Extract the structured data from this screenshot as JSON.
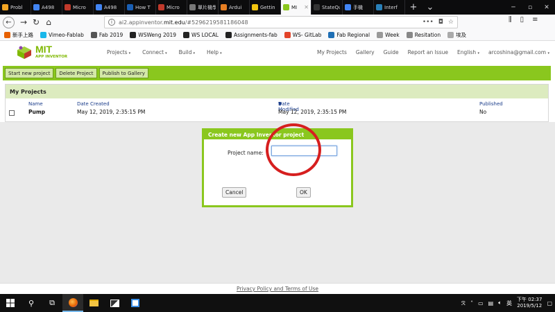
{
  "browser": {
    "tabs": [
      {
        "label": "Probl",
        "color": "#f5a623"
      },
      {
        "label": "A498",
        "color": "#4285f4"
      },
      {
        "label": "Micro",
        "color": "#c0392b"
      },
      {
        "label": "A498",
        "color": "#4285f4"
      },
      {
        "label": "How T",
        "color": "#1a5fb4"
      },
      {
        "label": "Micro",
        "color": "#c0392b"
      },
      {
        "label": "單片機學",
        "color": "#777777"
      },
      {
        "label": "Ardui",
        "color": "#e67e22"
      },
      {
        "label": "Gettin",
        "color": "#f1c40f"
      },
      {
        "label": "MI",
        "color": "#8ac71e",
        "active": true
      },
      {
        "label": "StateQui",
        "color": "#333333"
      },
      {
        "label": "手機",
        "color": "#4285f4"
      },
      {
        "label": "Interf",
        "color": "#2980b9"
      }
    ],
    "new_tab": "+",
    "url_prefix": "ai2.appinventor.",
    "url_host": "mit.edu",
    "url_path": "/#5296219581186048",
    "url_more": "•••",
    "bookmarks": [
      {
        "label": "新手上路",
        "color": "#e66000"
      },
      {
        "label": "Vimeo-Fablab",
        "color": "#1ab7ea"
      },
      {
        "label": "Fab 2019",
        "color": "#555555"
      },
      {
        "label": "WSWeng 2019",
        "color": "#222222"
      },
      {
        "label": "WS LOCAL",
        "color": "#222222"
      },
      {
        "label": "Assignments-fab",
        "color": "#222222"
      },
      {
        "label": "WS- GitLab",
        "color": "#e24329"
      },
      {
        "label": "Fab Regional",
        "color": "#1f6fb5"
      },
      {
        "label": "Week",
        "color": "#999999"
      },
      {
        "label": "Resitation",
        "color": "#888888"
      },
      {
        "label": "埃及",
        "color": "#aaaaaa"
      }
    ]
  },
  "app": {
    "logo_mit": "MIT",
    "logo_sub": "APP INVENTOR",
    "menu": [
      "Projects",
      "Connect",
      "Build",
      "Help"
    ],
    "right_menu": {
      "my_projects": "My Projects",
      "gallery": "Gallery",
      "guide": "Guide",
      "report": "Report an Issue",
      "language": "English",
      "account": "arcoshina@gmail.com"
    },
    "toolbar": {
      "start": "Start new project",
      "delete": "Delete Project",
      "publish": "Publish to Gallery"
    },
    "projects": {
      "title": "My Projects",
      "headers": {
        "name": "Name",
        "created": "Date Created",
        "modified": "Date Modified",
        "sort_indicator": "▼",
        "published": "Published"
      },
      "rows": [
        {
          "name": "Pump",
          "created": "May 12, 2019, 2:35:15 PM",
          "modified": "May 12, 2019, 2:35:15 PM",
          "published": "No"
        }
      ]
    },
    "dialog": {
      "title": "Create new App Inventor project",
      "label": "Project name:",
      "value": "",
      "cancel": "Cancel",
      "ok": "OK"
    },
    "footer": "Privacy Policy and Terms of Use"
  },
  "taskbar": {
    "ime": "英",
    "time": "下午 02:37",
    "date": "2019/5/12"
  }
}
